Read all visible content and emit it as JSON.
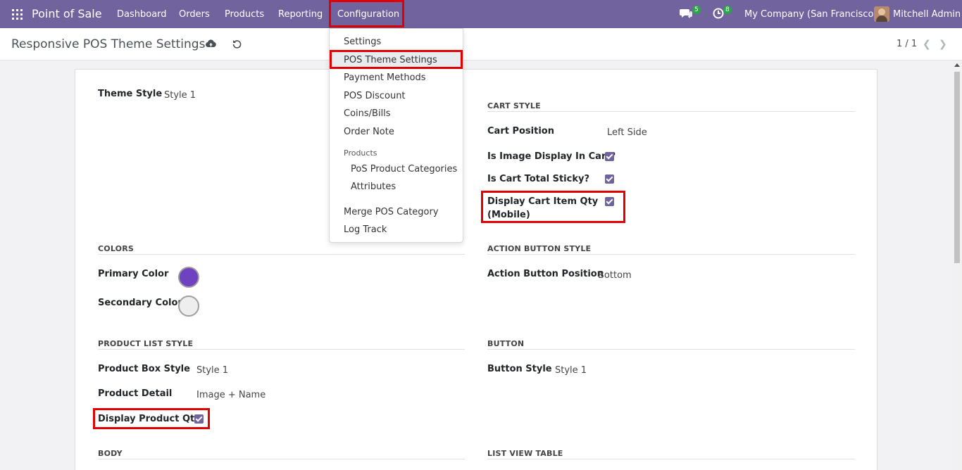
{
  "navbar": {
    "app_name": "Point of Sale",
    "menus": [
      "Dashboard",
      "Orders",
      "Products",
      "Reporting",
      "Configuration"
    ],
    "messages_count": "5",
    "activities_count": "8",
    "company": "My Company (San Francisco)",
    "user": "Mitchell Admin",
    "color": "#71639e"
  },
  "control": {
    "title": "Responsive POS Theme Settings",
    "pager": "1 / 1"
  },
  "dropdown": {
    "items": [
      "Settings",
      "POS Theme Settings",
      "Payment Methods",
      "POS Discount",
      "Coins/Bills",
      "Order Note"
    ],
    "section_header": "Products",
    "sub_items": [
      "PoS Product Categories",
      "Attributes"
    ],
    "bottom_items": [
      "Merge POS Category",
      "Log Track"
    ],
    "active": "POS Theme Settings"
  },
  "form": {
    "theme_style_label": "Theme Style",
    "theme_style_value": "Style 1",
    "cart_style": {
      "header": "CART STYLE",
      "cart_position_label": "Cart Position",
      "cart_position_value": "Left Side",
      "image_display_label": "Is Image Display In Cart?",
      "image_display_checked": true,
      "cart_total_sticky_label": "Is Cart Total Sticky?",
      "cart_total_sticky_checked": true,
      "display_qty_label_line1": "Display Cart Item Qty",
      "display_qty_label_line2": "(Mobile)",
      "display_qty_checked": true
    },
    "colors": {
      "header": "COLORS",
      "primary_label": "Primary Color",
      "primary_color": "#6f42c1",
      "secondary_label": "Secondary Color",
      "secondary_color": "#eeeeee"
    },
    "action_button": {
      "header": "ACTION BUTTON STYLE",
      "position_label": "Action Button Position",
      "position_value": "Bottom"
    },
    "product_list": {
      "header": "PRODUCT LIST STYLE",
      "box_style_label": "Product Box Style",
      "box_style_value": "Style 1",
      "detail_label": "Product Detail",
      "detail_value": "Image + Name",
      "display_qty_label": "Display Product Qty",
      "display_qty_checked": true
    },
    "button": {
      "header": "BUTTON",
      "style_label": "Button Style",
      "style_value": "Style 1"
    },
    "body_header": "BODY",
    "list_view_header": "LIST VIEW TABLE"
  }
}
